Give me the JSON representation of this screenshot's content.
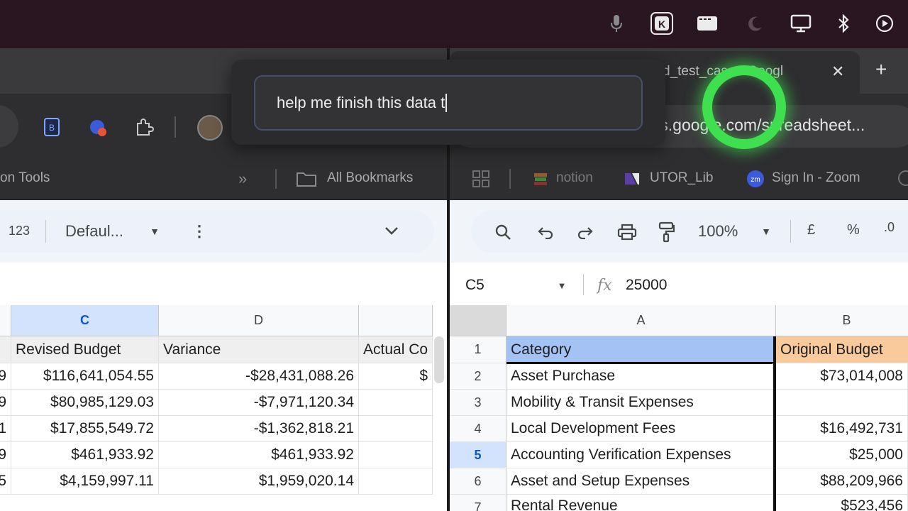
{
  "menubar": {
    "icons": [
      "microphone-icon",
      "k-app-icon",
      "window-icon",
      "moon-icon",
      "display-icon",
      "bluetooth-icon",
      "play-icon"
    ]
  },
  "prompt": {
    "text": "help me finish this data t"
  },
  "left_window": {
    "bookmarks": {
      "truncated_item": "on Tools",
      "overflow": "»",
      "all_bookmarks": "All Bookmarks"
    },
    "sheet_toolbar": {
      "number_format": "123",
      "font": "Defaul...",
      "more": "⋮",
      "expand": "⌄"
    },
    "columns": [
      "C",
      "D",
      ""
    ],
    "header_row": [
      "Revised Budget",
      "Variance",
      "Actual Co"
    ],
    "rows": [
      {
        "b_tail": "9",
        "c": "$116,641,054.55",
        "d": "-$28,431,088.26",
        "e": "$"
      },
      {
        "b_tail": "9",
        "c": "$80,985,129.03",
        "d": "-$7,971,120.34",
        "e": ""
      },
      {
        "b_tail": "1",
        "c": "$17,855,549.72",
        "d": "-$1,362,818.21",
        "e": ""
      },
      {
        "b_tail": "9",
        "c": "$461,933.92",
        "d": "$461,933.92",
        "e": ""
      },
      {
        "b_tail": "5",
        "c": "$4,159,997.11",
        "d": "$1,959,020.14",
        "e": ""
      }
    ]
  },
  "right_window": {
    "tab": {
      "title": "d_test_case - Googl",
      "close": "✕",
      "new_tab": "+"
    },
    "url": "ocs.google.com/spreadsheet...",
    "bookmarks": {
      "items": [
        "notion",
        "UTOR_Lib",
        "Sign In - Zoom"
      ]
    },
    "sheet_toolbar": {
      "zoom": "100%",
      "currency": "£",
      "percent": "%",
      "decimal": ".0"
    },
    "name_box": "C5",
    "fx": "fx",
    "formula_value": "25000",
    "columns": [
      "A",
      "B"
    ],
    "header_row": {
      "a": "Category",
      "b": "Original Budget"
    },
    "rows": [
      {
        "num": "2",
        "a": "Asset Purchase",
        "b": "$73,014,008"
      },
      {
        "num": "3",
        "a": "Mobility & Transit Expenses",
        "b": ""
      },
      {
        "num": "4",
        "a": "Local Development Fees",
        "b": "$16,492,731"
      },
      {
        "num": "5",
        "a": "Accounting Verification Expenses",
        "b": "$25,000"
      },
      {
        "num": "6",
        "a": "Asset and Setup Expenses",
        "b": "$88,209,966"
      },
      {
        "num": "7",
        "a": "Rental Revenue",
        "b": "$523,456"
      }
    ],
    "header_num": "1"
  },
  "colors": {
    "category_fill": "#a4c2f4",
    "budget_fill": "#f9cb9c",
    "cursor_ring": "#3ee04f"
  }
}
